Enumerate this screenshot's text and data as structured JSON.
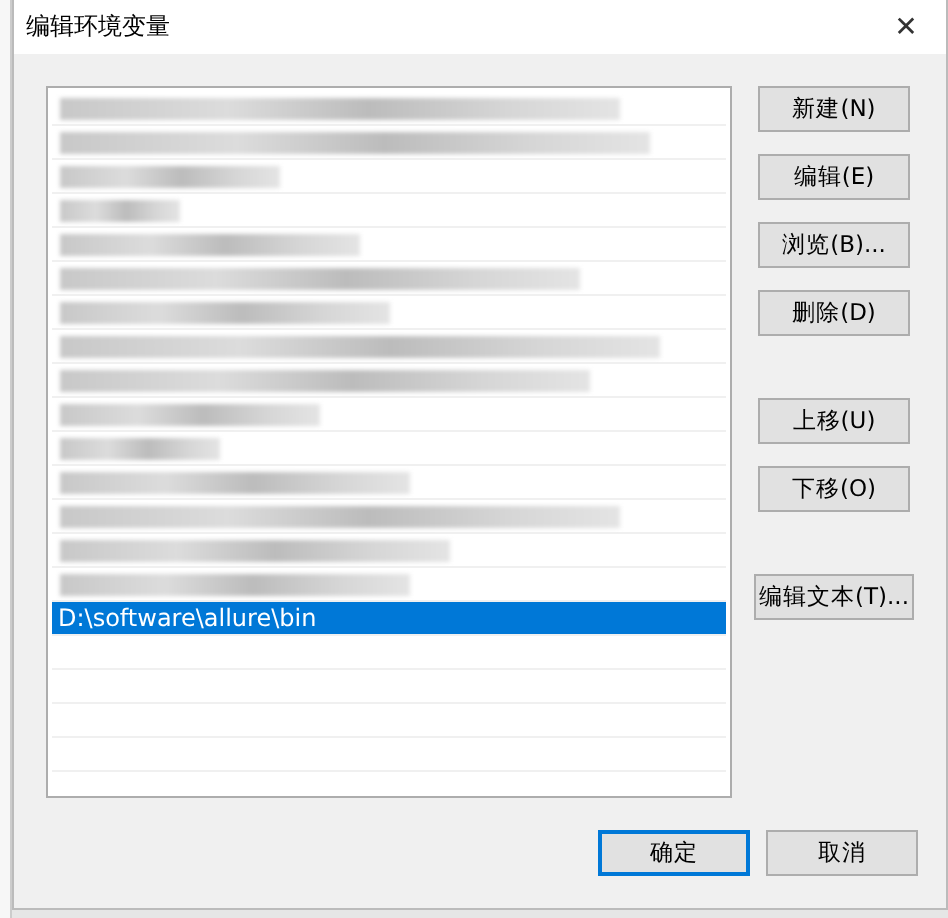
{
  "window": {
    "title": "编辑环境变量",
    "close": "✕"
  },
  "list": {
    "items": [
      {
        "kind": "redacted",
        "selected": false
      },
      {
        "kind": "redacted",
        "selected": false
      },
      {
        "kind": "redacted",
        "selected": false
      },
      {
        "kind": "redacted",
        "selected": false
      },
      {
        "kind": "redacted",
        "selected": false
      },
      {
        "kind": "redacted",
        "selected": false
      },
      {
        "kind": "redacted",
        "selected": false
      },
      {
        "kind": "redacted",
        "selected": false
      },
      {
        "kind": "redacted",
        "selected": false
      },
      {
        "kind": "redacted",
        "selected": false
      },
      {
        "kind": "redacted",
        "selected": false
      },
      {
        "kind": "redacted",
        "selected": false
      },
      {
        "kind": "redacted",
        "selected": false
      },
      {
        "kind": "redacted",
        "selected": false
      },
      {
        "kind": "redacted",
        "selected": false
      },
      {
        "kind": "text",
        "text": "D:\\software\\allure\\bin",
        "selected": true
      }
    ]
  },
  "side_button_groups": [
    [
      "新建(N)",
      "编辑(E)",
      "浏览(B)...",
      "删除(D)"
    ],
    [
      "上移(U)",
      "下移(O)"
    ],
    [
      "编辑文本(T)..."
    ]
  ],
  "footer_buttons": [
    {
      "label": "确定",
      "default": true
    },
    {
      "label": "取消",
      "default": false
    }
  ]
}
